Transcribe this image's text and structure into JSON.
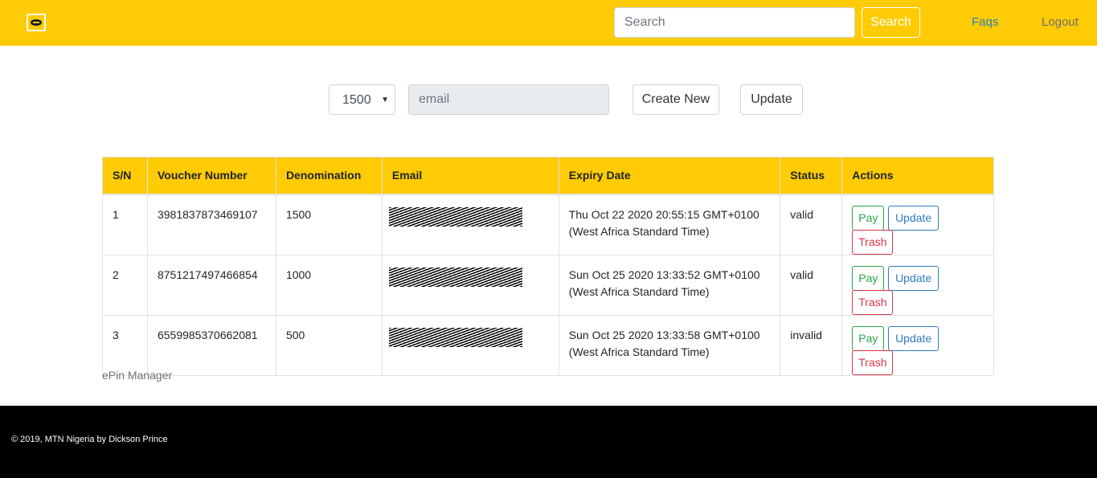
{
  "navbar": {
    "logo_text": "MTN",
    "search_placeholder": "Search",
    "search_button": "Search",
    "links": {
      "faqs": "Faqs",
      "logout": "Logout"
    },
    "colors": {
      "background": "#ffcb05",
      "faqs": "#2e7cbe",
      "logout": "#6f6f6f"
    }
  },
  "form": {
    "denomination_selected": "1500",
    "email_placeholder": "email",
    "create_button": "Create New",
    "update_button": "Update"
  },
  "table": {
    "headers": [
      "S/N",
      "Voucher Number",
      "Denomination",
      "Email",
      "Expiry Date",
      "Status",
      "Actions"
    ],
    "rows": [
      {
        "sn": "1",
        "voucher": "3981837873469107",
        "denomination": "1500",
        "email": "[redacted]",
        "expiry_line1": "Thu Oct 22 2020 20:55:15 GMT+0100",
        "expiry_line2": "(West Africa Standard Time)",
        "status": "valid"
      },
      {
        "sn": "2",
        "voucher": "8751217497466854",
        "denomination": "1000",
        "email": "[redacted]",
        "expiry_line1": "Sun Oct 25 2020 13:33:52 GMT+0100",
        "expiry_line2": "(West Africa Standard Time)",
        "status": "valid"
      },
      {
        "sn": "3",
        "voucher": "6559985370662081",
        "denomination": "500",
        "email": "[redacted]",
        "expiry_line1": "Sun Oct 25 2020 13:33:58 GMT+0100",
        "expiry_line2": "(West Africa Standard Time)",
        "status": "invalid"
      }
    ],
    "actions": {
      "pay": "Pay",
      "update": "Update",
      "trash": "Trash"
    },
    "caption": "ePin Manager",
    "header_color": "#ffcb05"
  },
  "footer": {
    "text": "© 2019, MTN Nigeria by Dickson Prince",
    "background": "#000000"
  }
}
